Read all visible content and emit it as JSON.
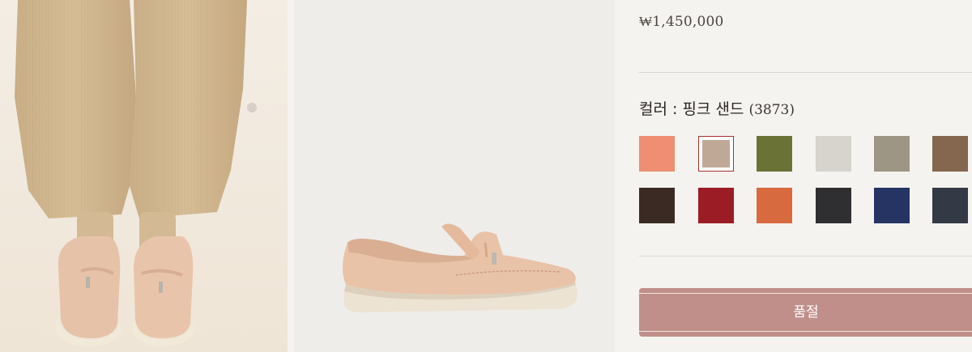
{
  "product": {
    "price": "₩1,450,000",
    "color_label": "컬러 : 핑크 샌드 ",
    "color_code": "(3873)",
    "swatches": [
      {
        "color": "#ef8e73",
        "selected": false
      },
      {
        "color": "#bfa996",
        "selected": true
      },
      {
        "color": "#6b7236",
        "selected": false
      },
      {
        "color": "#d6d4cd",
        "selected": false
      },
      {
        "color": "#9d9684",
        "selected": false
      },
      {
        "color": "#84674e",
        "selected": false
      },
      {
        "color": "#3b2a24",
        "selected": false
      },
      {
        "color": "#9b1c24",
        "selected": false
      },
      {
        "color": "#d86a3f",
        "selected": false
      },
      {
        "color": "#2f2f31",
        "selected": false
      },
      {
        "color": "#263464",
        "selected": false
      },
      {
        "color": "#333945",
        "selected": false
      }
    ],
    "soldout_label": "품절"
  },
  "colors": {
    "button": "#c08f89",
    "selected_border": "#a8302a"
  }
}
